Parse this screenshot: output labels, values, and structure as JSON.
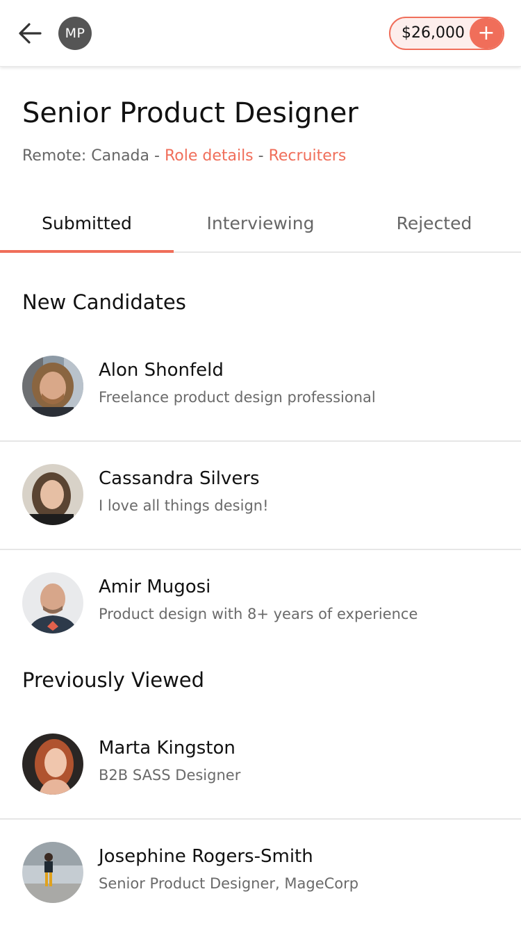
{
  "header": {
    "user_initials": "MP",
    "balance": "$26,000",
    "add_symbol": "+"
  },
  "job": {
    "title": "Senior Product Designer",
    "location": "Remote: Canada",
    "separator": " - ",
    "role_details_link": "Role details",
    "recruiters_link": "Recruiters"
  },
  "tabs": [
    {
      "label": "Submitted",
      "active": true
    },
    {
      "label": "Interviewing",
      "active": false
    },
    {
      "label": "Rejected",
      "active": false
    }
  ],
  "sections": {
    "new_candidates": "New Candidates",
    "previously_viewed": "Previously Viewed"
  },
  "new_candidates": [
    {
      "name": "Alon Shonfeld",
      "description": "Freelance product design professional"
    },
    {
      "name": "Cassandra Silvers",
      "description": "I love all things design!"
    },
    {
      "name": "Amir Mugosi",
      "description": "Product design with 8+ years of experience"
    }
  ],
  "previously_viewed": [
    {
      "name": "Marta Kingston",
      "description": "B2B SASS Designer"
    },
    {
      "name": "Josephine Rogers-Smith",
      "description": "Senior Product Designer, MageCorp"
    }
  ],
  "colors": {
    "accent": "#f06e5a",
    "pill_background": "#fdeeec",
    "initials_avatar": "#555555",
    "divider": "#e6e6e6",
    "secondary_text": "#666666"
  },
  "icons": {
    "back": "arrow-left-icon",
    "add": "plus-icon"
  }
}
